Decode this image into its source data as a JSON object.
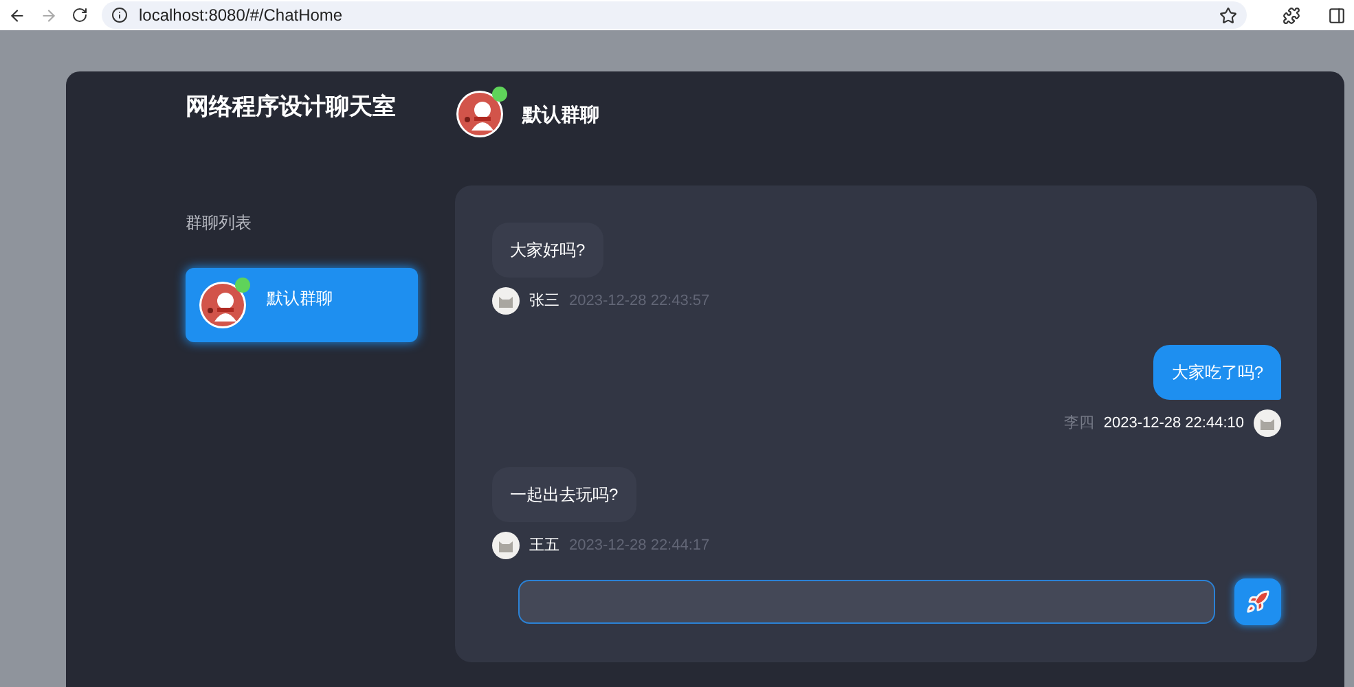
{
  "browser": {
    "url": "localhost:8080/#/ChatHome"
  },
  "app": {
    "title": "网络程序设计聊天室"
  },
  "sidebar": {
    "heading": "群聊列表",
    "groups": [
      {
        "name": "默认群聊",
        "online": true,
        "selected": true
      }
    ]
  },
  "chat": {
    "title": "默认群聊",
    "online": true,
    "messages": [
      {
        "kind": "received",
        "text": "大家好吗?",
        "sender": "张三",
        "time": "2023-12-28 22:43:57"
      },
      {
        "kind": "sent",
        "text": "大家吃了吗?",
        "sender": "李四",
        "time": "2023-12-28 22:44:10"
      },
      {
        "kind": "received",
        "text": "一起出去玩吗?",
        "sender": "王五",
        "time": "2023-12-28 22:44:17"
      }
    ]
  }
}
